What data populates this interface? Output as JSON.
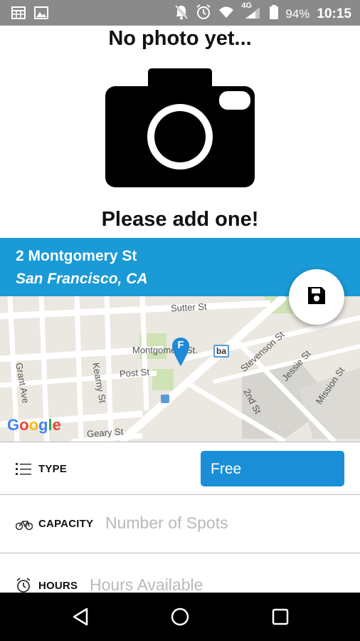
{
  "status_bar": {
    "network": "4G",
    "battery": "94%",
    "time": "10:15"
  },
  "photo": {
    "no_photo_text": "No photo yet...",
    "prompt_text": "Please add one!"
  },
  "address": {
    "street": "2 Montgomery St",
    "city": "San Francisco, CA"
  },
  "map": {
    "streets": [
      "Sutter St",
      "Post St",
      "Geary St",
      "Grant Ave",
      "Kearny St",
      "2nd St",
      "Stevenson St",
      "Jessie St",
      "Mission St"
    ],
    "station_label": "Montgomery St.",
    "station_marker": "F",
    "bart_badge": "ba",
    "logo": "Google"
  },
  "form": {
    "type_label": "TYPE",
    "type_value": "Free",
    "capacity_label": "CAPACITY",
    "capacity_placeholder": "Number of Spots",
    "hours_label": "HOURS",
    "hours_placeholder": "Hours Available"
  },
  "colors": {
    "accent": "#1a9ad6",
    "button": "#1a8fd8"
  }
}
